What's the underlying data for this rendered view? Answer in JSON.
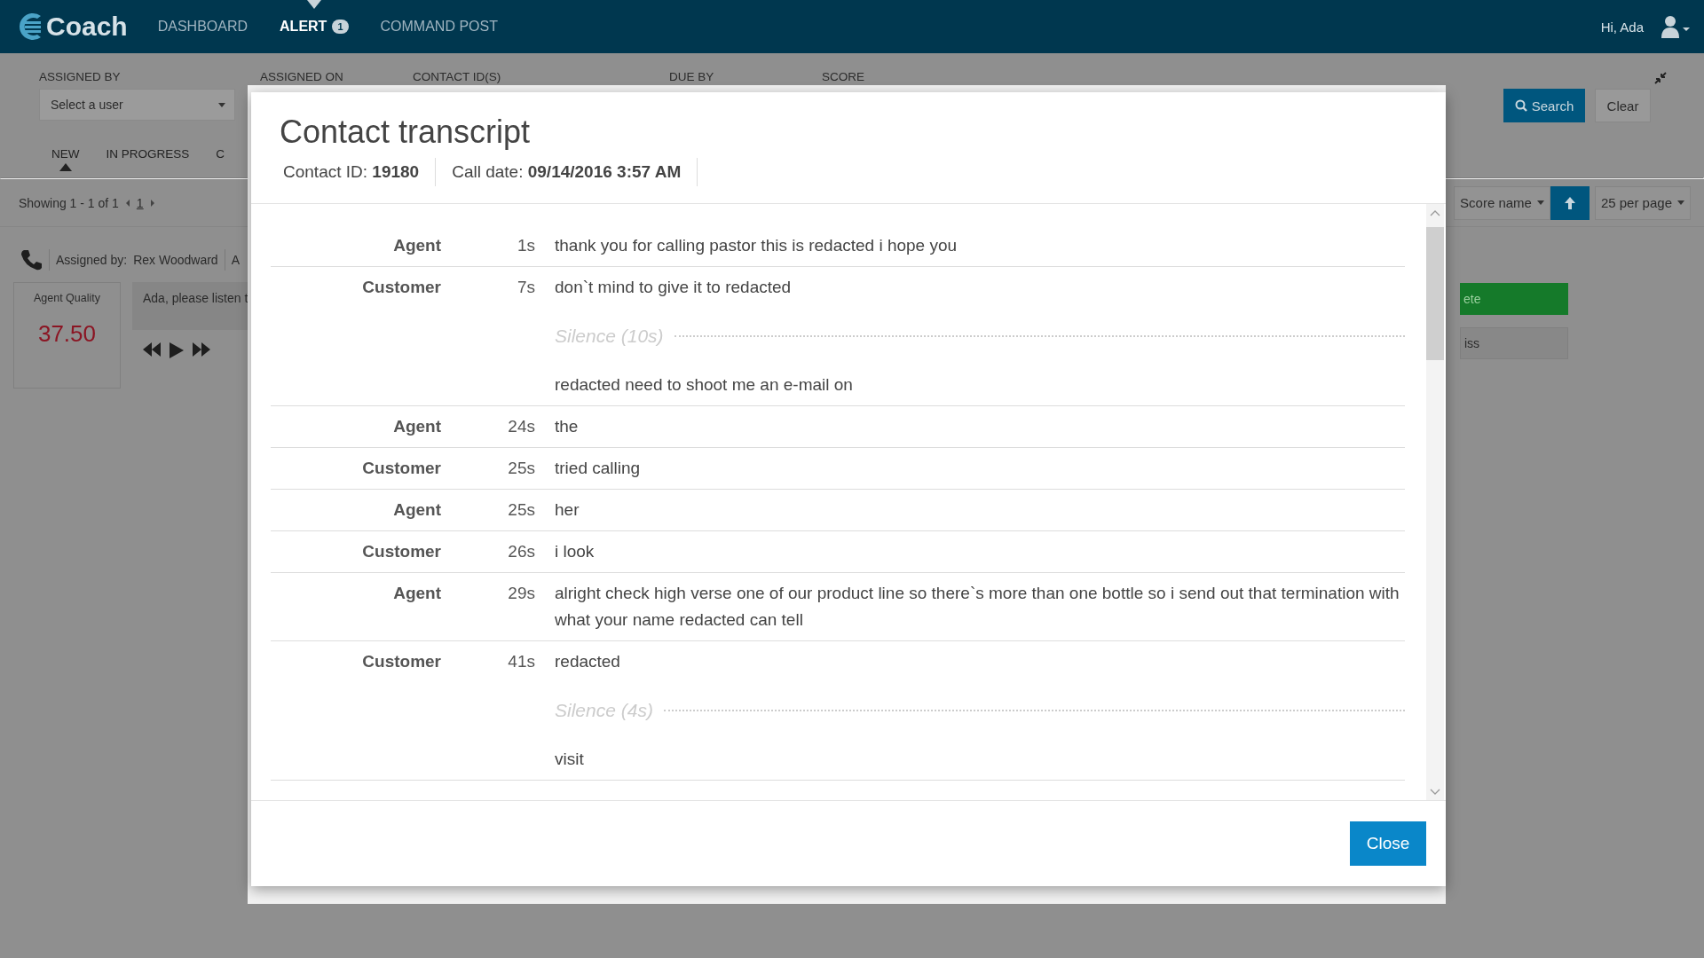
{
  "nav": {
    "logo": "Coach",
    "items": [
      {
        "label": "DASHBOARD",
        "selected": false
      },
      {
        "label": "ALERT",
        "selected": true,
        "badge": "1"
      },
      {
        "label": "COMMAND POST",
        "selected": false
      }
    ],
    "greeting": "Hi, Ada"
  },
  "filters": {
    "fields": [
      {
        "label": "ASSIGNED BY",
        "placeholder": "Select a user"
      },
      {
        "label": "ASSIGNED ON"
      },
      {
        "label": "CONTACT ID(S)"
      },
      {
        "label": "DUE BY"
      },
      {
        "label": "SCORE"
      }
    ],
    "search": "Search",
    "clear": "Clear"
  },
  "status_tabs": [
    {
      "label": "NEW",
      "selected": true
    },
    {
      "label": "IN PROGRESS",
      "selected": false
    },
    {
      "label": "C",
      "selected": false
    }
  ],
  "pager": {
    "summary": "Showing 1 - 1 of 1",
    "page": "1"
  },
  "sort": {
    "field": "Score name",
    "per_page": "25 per page"
  },
  "alert": {
    "assigned_by_label": "Assigned by:",
    "assigned_by": "Rex Woodward",
    "extra": "A",
    "score_label": "Agent Quality",
    "score": "37.50",
    "message": "Ada, please listen t",
    "actions": [
      {
        "label": "ete",
        "kind": "primary"
      },
      {
        "label": "iss",
        "kind": "default"
      }
    ]
  },
  "modal": {
    "title": "Contact transcript",
    "contact_id": "Contact ID: **19180**",
    "call_date": "Call date: **09/14/2016 3:57 AM**",
    "transcript": [
      {
        "speaker": "Agent",
        "time": "1s",
        "segments": [
          {
            "kind": "speech",
            "text": "thank you for calling pastor this is redacted i hope you"
          }
        ]
      },
      {
        "speaker": "Customer",
        "time": "7s",
        "segments": [
          {
            "kind": "speech",
            "text": "don`t mind to give it to redacted"
          },
          {
            "kind": "silence",
            "text": "Silence (10s)"
          },
          {
            "kind": "speech",
            "text": "redacted need to shoot me an e-mail on"
          }
        ]
      },
      {
        "speaker": "Agent",
        "time": "24s",
        "segments": [
          {
            "kind": "speech",
            "text": "the"
          }
        ]
      },
      {
        "speaker": "Customer",
        "time": "25s",
        "segments": [
          {
            "kind": "speech",
            "text": "tried calling"
          }
        ]
      },
      {
        "speaker": "Agent",
        "time": "25s",
        "segments": [
          {
            "kind": "speech",
            "text": "her"
          }
        ]
      },
      {
        "speaker": "Customer",
        "time": "26s",
        "segments": [
          {
            "kind": "speech",
            "text": "i look"
          }
        ]
      },
      {
        "speaker": "Agent",
        "time": "29s",
        "segments": [
          {
            "kind": "speech",
            "text": "alright check high verse one of our product line so there`s more than one bottle so i send out that termination with what your name redacted can tell"
          }
        ]
      },
      {
        "speaker": "Customer",
        "time": "41s",
        "segments": [
          {
            "kind": "speech",
            "text": "redacted"
          },
          {
            "kind": "silence",
            "text": "Silence (4s)"
          },
          {
            "kind": "speech",
            "text": "visit"
          }
        ]
      }
    ],
    "close": "Close"
  }
}
